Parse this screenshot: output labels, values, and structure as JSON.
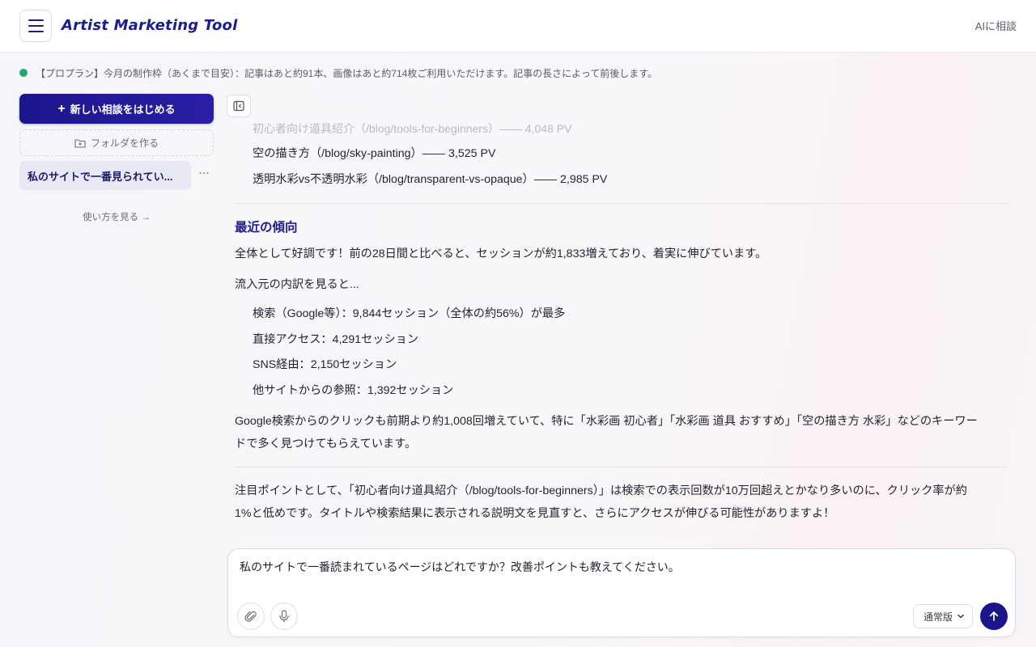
{
  "header": {
    "brand": "Artist Marketing Tool",
    "ai_consult": "AIに相談"
  },
  "notice": {
    "text": "【プロプラン】今月の制作枠（あくまで目安）：記事はあと約91本、画像はあと約714枚ご利用いただけます。記事の長さによって前後します。",
    "status_color": "#22a867"
  },
  "sidebar": {
    "new_consult_label": "新しい相談をはじめる",
    "new_folder_label": "フォルダを作る",
    "chats": [
      {
        "title": "私のサイトで一番見られてい...",
        "more": "···"
      }
    ],
    "howto_label": "使い方を見る →"
  },
  "content": {
    "page_list": [
      "初心者向け道具紹介（/blog/tools-for-beginners）—— 4,048 PV",
      "空の描き方（/blog/sky-painting）—— 3,525 PV",
      "透明水彩vs不透明水彩（/blog/transparent-vs-opaque）—— 2,985 PV"
    ],
    "trend_title": "最近の傾向",
    "trend_summary": "全体として好調です！前の28日間と比べると、セッションが約1,833増えており、着実に伸びています。",
    "sources_intro": "流入元の内訳を見ると...",
    "sources": [
      "検索（Google等）：9,844セッション（全体の約56%）が最多",
      "直接アクセス：4,291セッション",
      "SNS経由：2,150セッション",
      "他サイトからの参照：1,392セッション"
    ],
    "google_para_line1": "Google検索からのクリックも前期より約1,008回増えていて、特に「水彩画 初心者」「水彩画 道具 おすすめ」「空の描き方 水彩」などのキーワー",
    "google_para_line2": "ドで多く見つけてもらえています。",
    "notice_para_line1": "注目ポイントとして、「初心者向け道具紹介（/blog/tools-for-beginners）」は検索での表示回数が10万回超えとかなり多いのに、クリック率が約",
    "notice_para_line2": "1%と低めです。タイトルや検索結果に表示される説明文を見直すと、さらにアクセスが伸びる可能性がありますよ！"
  },
  "composer": {
    "input_value": "私のサイトで一番読まれているページはどれですか？改善ポイントも教えてください。",
    "model_selected": "通常版",
    "accent_color": "#1b158b"
  }
}
